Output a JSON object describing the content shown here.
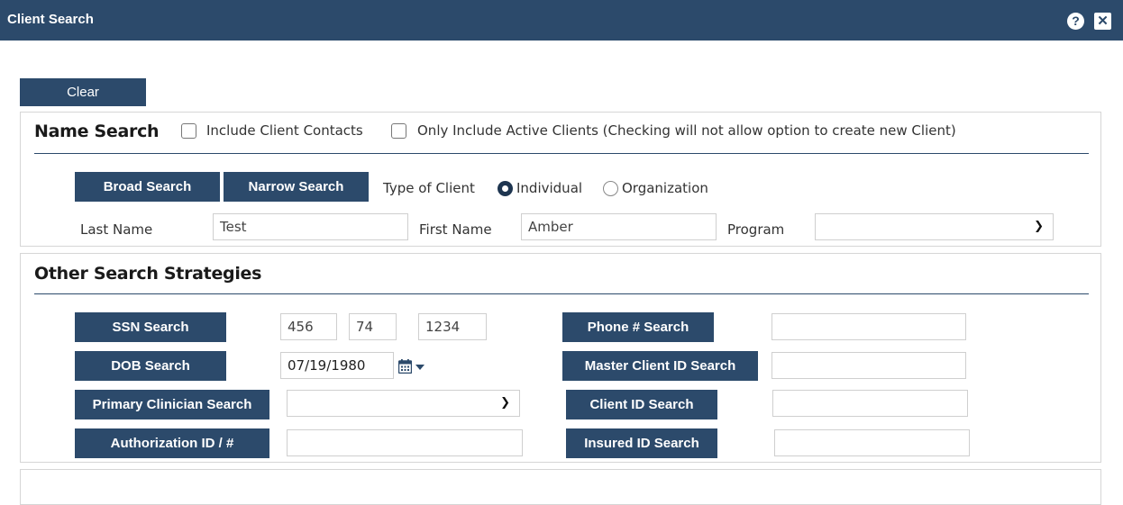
{
  "window": {
    "title": "Client Search",
    "help_icon": "?",
    "close_icon": "✕"
  },
  "clear_button": "Clear",
  "name_search": {
    "title": "Name Search",
    "include_contacts_label": "Include Client Contacts",
    "active_clients_label": "Only Include Active Clients (Checking will not allow option to create new Client)",
    "broad_button": "Broad Search",
    "narrow_button": "Narrow Search",
    "type_label": "Type of Client",
    "individual_label": "Individual",
    "organization_label": "Organization",
    "selected_type": "Individual",
    "last_name_label": "Last Name",
    "last_name_value": "Test",
    "first_name_label": "First Name",
    "first_name_value": "Amber",
    "program_label": "Program",
    "program_value": ""
  },
  "other_search": {
    "title": "Other Search Strategies",
    "ssn_button": "SSN Search",
    "ssn_1": "456",
    "ssn_2": "74",
    "ssn_3": "1234",
    "dob_button": "DOB Search",
    "dob_value": "07/19/1980",
    "clinician_button": "Primary Clinician Search",
    "clinician_value": "",
    "auth_button": "Authorization ID / #",
    "auth_value": "",
    "phone_button": "Phone # Search",
    "phone_value": "",
    "master_button": "Master Client ID Search",
    "master_value": "",
    "client_id_button": "Client ID Search",
    "client_id_value": "",
    "insured_button": "Insured ID Search",
    "insured_value": ""
  },
  "colors": {
    "header": "#2c4a6b",
    "button": "#2c4a6b"
  }
}
